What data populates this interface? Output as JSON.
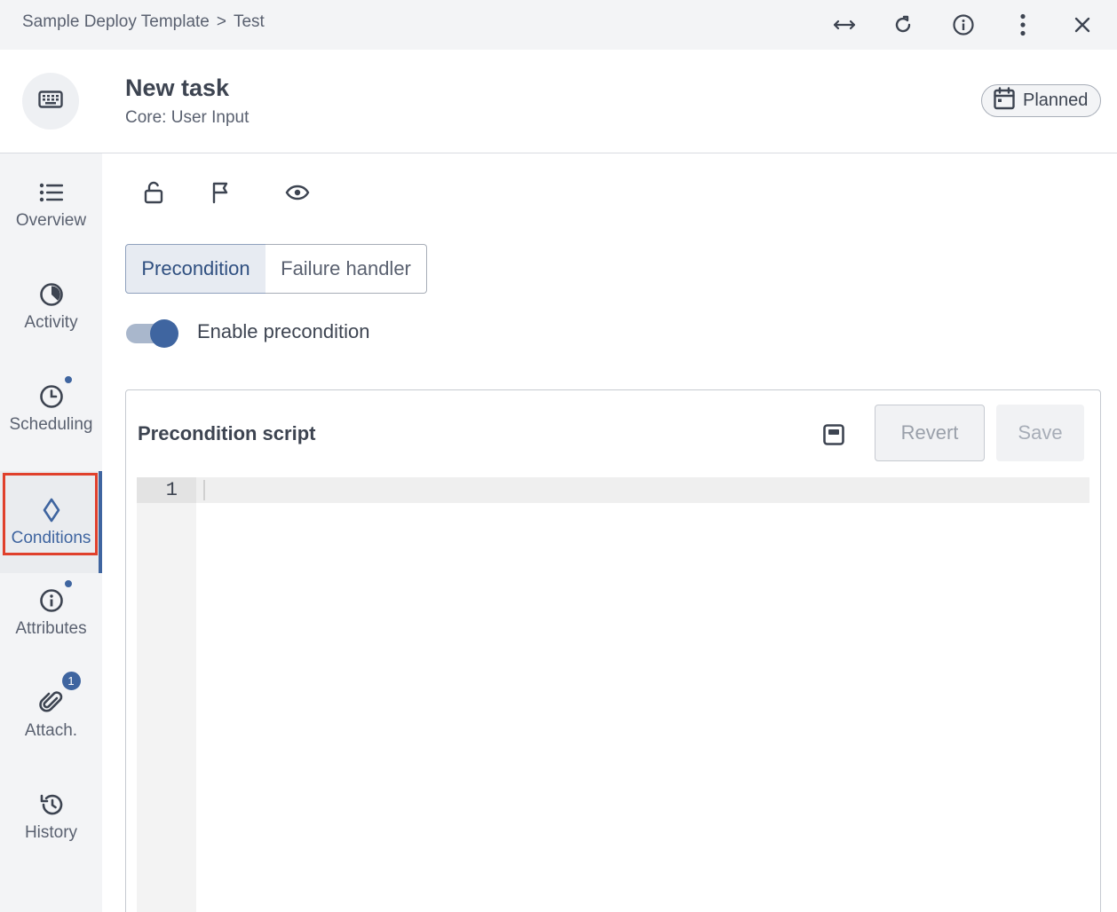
{
  "breadcrumb": {
    "parent": "Sample Deploy Template",
    "separator": ">",
    "current": "Test"
  },
  "topbar_icons": [
    "expand-horizontal-icon",
    "refresh-icon",
    "info-icon",
    "more-vertical-icon",
    "close-icon"
  ],
  "task": {
    "title": "New task",
    "subtitle": "Core: User Input",
    "status": "Planned",
    "type_icon": "keyboard-icon"
  },
  "sidebar": {
    "items": [
      {
        "label": "Overview",
        "icon": "list-icon"
      },
      {
        "label": "Activity",
        "icon": "pie-clock-icon"
      },
      {
        "label": "Scheduling",
        "icon": "clock-icon",
        "dot": true
      },
      {
        "label": "Conditions",
        "icon": "diamond-icon",
        "active": true
      },
      {
        "label": "Attributes",
        "icon": "info-icon",
        "dot": true
      },
      {
        "label": "Attach.",
        "icon": "paperclip-icon",
        "badge": "1"
      },
      {
        "label": "History",
        "icon": "history-icon"
      }
    ]
  },
  "toolbar_icons": [
    "lock-open-icon",
    "flag-icon",
    "eye-icon"
  ],
  "tabs": {
    "precondition": "Precondition",
    "failure_handler": "Failure handler"
  },
  "toggle": {
    "label": "Enable precondition",
    "enabled": true
  },
  "editor": {
    "title": "Precondition script",
    "revert_label": "Revert",
    "save_label": "Save",
    "line_number": "1",
    "content": ""
  },
  "colors": {
    "accent": "#3f65a0",
    "highlight": "#e0402c"
  }
}
